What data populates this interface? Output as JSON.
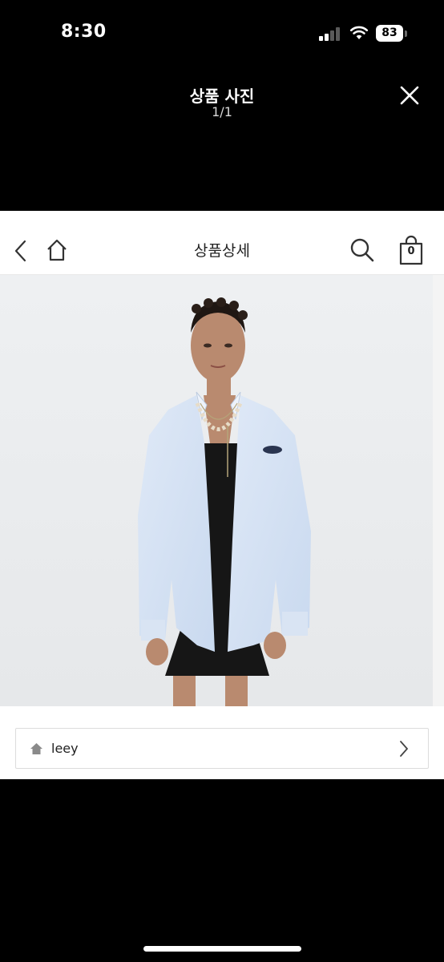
{
  "status_bar": {
    "time": "8:30",
    "battery_level": "83",
    "icons": [
      "signal-icon",
      "wifi-icon",
      "battery-icon"
    ]
  },
  "viewer": {
    "title": "상품 사진",
    "counter": "1/1",
    "close_icon": "close-icon"
  },
  "page": {
    "nav": {
      "title": "상품상세",
      "back_icon": "chevron-left-icon",
      "home_icon": "home-icon",
      "search_icon": "search-icon",
      "cart_icon": "shopping-bag-icon",
      "cart_count": "0"
    },
    "product_image": {
      "subject": "model wearing oversized light blue shirt over black mini dress"
    },
    "shop": {
      "icon": "home-icon",
      "name": "leey",
      "chevron_icon": "chevron-right-icon"
    }
  },
  "colors": {
    "background": "#000000",
    "card": "#ffffff",
    "image_backdrop": "#eceeef",
    "text_dark": "#222222",
    "border": "#dcdcdc"
  }
}
